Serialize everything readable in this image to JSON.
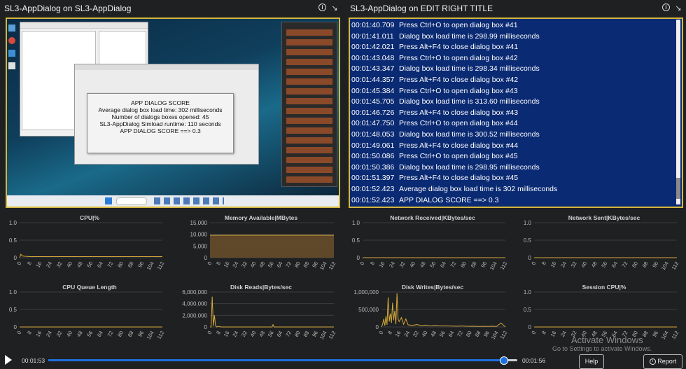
{
  "left_panel": {
    "title": "SL3-AppDialog on SL3-AppDialog"
  },
  "right_panel": {
    "title": "SL3-AppDialog on EDIT RIGHT TITLE"
  },
  "screenshot": {
    "dialog_title": "APP DIALOG SCORE",
    "dialog_lines": [
      "Average dialog box load time: 302 milliseconds",
      "Number of dialogs boxes opened: 45",
      "SL3-AppDialog Simload runtime: 110 seconds",
      "APP DIALOG SCORE ==> 0.3"
    ]
  },
  "log": [
    {
      "time": "00:01:40.709",
      "msg": "Press Ctrl+O to open dialog box #41"
    },
    {
      "time": "00:01:41.011",
      "msg": "Dialog box load time is 298.99 milliseconds"
    },
    {
      "time": "00:01:42.021",
      "msg": "Press Alt+F4 to close dialog box #41"
    },
    {
      "time": "00:01:43.048",
      "msg": "Press Ctrl+O to open dialog box #42"
    },
    {
      "time": "00:01:43.347",
      "msg": "Dialog box load time is 298.34 milliseconds"
    },
    {
      "time": "00:01:44.357",
      "msg": "Press Alt+F4 to close dialog box #42"
    },
    {
      "time": "00:01:45.384",
      "msg": "Press Ctrl+O to open dialog box #43"
    },
    {
      "time": "00:01:45.705",
      "msg": "Dialog box load time is 313.60 milliseconds"
    },
    {
      "time": "00:01:46.726",
      "msg": "Press Alt+F4 to close dialog box #43"
    },
    {
      "time": "00:01:47.750",
      "msg": "Press Ctrl+O to open dialog box #44"
    },
    {
      "time": "00:01:48.053",
      "msg": "Dialog box load time is 300.52 milliseconds"
    },
    {
      "time": "00:01:49.061",
      "msg": "Press Alt+F4 to close dialog box #44"
    },
    {
      "time": "00:01:50.086",
      "msg": "Press Ctrl+O to open dialog box #45"
    },
    {
      "time": "00:01:50.386",
      "msg": "Dialog box load time is 298.95 milliseconds"
    },
    {
      "time": "00:01:51.397",
      "msg": "Press Alt+F4 to close dialog box #45"
    },
    {
      "time": "00:01:52.423",
      "msg": "Average dialog box load time is 302 milliseconds"
    },
    {
      "time": "00:01:52.423",
      "msg": "APP DIALOG SCORE ==> 0.3"
    }
  ],
  "player": {
    "current": "00:01:53",
    "total": "00:01:56",
    "progress": 0.97,
    "help_label": "Help",
    "report_label": "Report"
  },
  "watermark": {
    "line1": "Activate Windows",
    "line2": "Go to Settings to activate Windows."
  },
  "colors": {
    "accent": "#d4b73c",
    "log_bg": "#0a2a73",
    "series": "#d4a93a",
    "slider": "#1e6fe0"
  },
  "chart_data": [
    {
      "type": "line",
      "title": "CPU|%",
      "yticks": [
        "1.0",
        "0.5",
        "0"
      ],
      "ylim": [
        0,
        1
      ],
      "xticks": [
        "0",
        "8",
        "16",
        "24",
        "32",
        "40",
        "48",
        "56",
        "64",
        "72",
        "80",
        "88",
        "96",
        "104",
        "112"
      ],
      "x": [
        0,
        1,
        2,
        4,
        8,
        16,
        24,
        32,
        40,
        48,
        56,
        64,
        72,
        80,
        88,
        96,
        104,
        112
      ],
      "y": [
        0,
        0.1,
        0.05,
        0.04,
        0.03,
        0.03,
        0.03,
        0.03,
        0.03,
        0.03,
        0.03,
        0.03,
        0.03,
        0.03,
        0.03,
        0.03,
        0.03,
        0.03
      ]
    },
    {
      "type": "area",
      "title": "Memory Available|MBytes",
      "yticks": [
        "15,000",
        "10,000",
        "5,000",
        "0"
      ],
      "ylim": [
        0,
        15000
      ],
      "xticks": [
        "0",
        "8",
        "16",
        "24",
        "32",
        "40",
        "48",
        "56",
        "64",
        "72",
        "80",
        "88",
        "96",
        "104",
        "112"
      ],
      "x": [
        0,
        112
      ],
      "y": [
        9600,
        9600
      ]
    },
    {
      "type": "line",
      "title": "Network Received|KBytes/sec",
      "yticks": [
        "1.0",
        "0.5",
        "0"
      ],
      "ylim": [
        0,
        1
      ],
      "xticks": [
        "0",
        "8",
        "16",
        "24",
        "32",
        "40",
        "48",
        "56",
        "64",
        "72",
        "80",
        "88",
        "96",
        "104",
        "112"
      ],
      "x": [
        0,
        112
      ],
      "y": [
        0,
        0
      ]
    },
    {
      "type": "line",
      "title": "Network Sent|KBytes/sec",
      "yticks": [
        "1.0",
        "0.5",
        "0"
      ],
      "ylim": [
        0,
        1
      ],
      "xticks": [
        "0",
        "8",
        "16",
        "24",
        "32",
        "40",
        "48",
        "56",
        "64",
        "72",
        "80",
        "88",
        "96",
        "104",
        "112"
      ],
      "x": [
        0,
        112
      ],
      "y": [
        0,
        0
      ]
    },
    {
      "type": "line",
      "title": "CPU Queue Length",
      "yticks": [
        "1.0",
        "0.5",
        "0"
      ],
      "ylim": [
        0,
        1
      ],
      "xticks": [
        "0",
        "8",
        "16",
        "24",
        "32",
        "40",
        "48",
        "56",
        "64",
        "72",
        "80",
        "88",
        "96",
        "104",
        "112"
      ],
      "x": [
        0,
        112
      ],
      "y": [
        0,
        0
      ]
    },
    {
      "type": "line",
      "title": "Disk Reads|Bytes/sec",
      "yticks": [
        "6,000,000",
        "4,000,000",
        "2,000,000",
        "0"
      ],
      "ylim": [
        0,
        6000000
      ],
      "xticks": [
        "0",
        "8",
        "16",
        "24",
        "32",
        "40",
        "48",
        "56",
        "64",
        "72",
        "80",
        "88",
        "96",
        "104",
        "112"
      ],
      "x": [
        0,
        1,
        2,
        3,
        4,
        5,
        6,
        8,
        10,
        20,
        40,
        48,
        56,
        57,
        58,
        64,
        80,
        112
      ],
      "y": [
        0,
        0,
        5200000,
        200000,
        2000000,
        300000,
        0,
        100000,
        0,
        0,
        0,
        0,
        0,
        400000,
        0,
        0,
        0,
        0
      ]
    },
    {
      "type": "line",
      "title": "Disk Writes|Bytes/sec",
      "yticks": [
        "1,000,000",
        "500,000",
        "0"
      ],
      "ylim": [
        0,
        1300000
      ],
      "xticks": [
        "0",
        "8",
        "16",
        "24",
        "32",
        "40",
        "48",
        "56",
        "64",
        "72",
        "80",
        "88",
        "96",
        "104",
        "112"
      ],
      "x": [
        0,
        1,
        2,
        3,
        4,
        5,
        6,
        7,
        8,
        9,
        10,
        11,
        12,
        13,
        14,
        15,
        16,
        18,
        20,
        22,
        24,
        28,
        32,
        36,
        40,
        44,
        48,
        52,
        56,
        60,
        64,
        68,
        72,
        76,
        80,
        84,
        88,
        92,
        96,
        100,
        104,
        108,
        112
      ],
      "y": [
        0,
        100000,
        300000,
        50000,
        400000,
        80000,
        1100000,
        200000,
        500000,
        150000,
        900000,
        250000,
        600000,
        100000,
        1250000,
        300000,
        200000,
        350000,
        100000,
        300000,
        80000,
        60000,
        90000,
        50000,
        70000,
        40000,
        60000,
        50000,
        45000,
        40000,
        35000,
        30000,
        40000,
        30000,
        25000,
        30000,
        20000,
        25000,
        20000,
        30000,
        20000,
        150000,
        0
      ]
    },
    {
      "type": "line",
      "title": "Session CPU|%",
      "yticks": [
        "1.0",
        "0.5",
        "0"
      ],
      "ylim": [
        0,
        1
      ],
      "xticks": [
        "0",
        "8",
        "16",
        "24",
        "32",
        "40",
        "48",
        "56",
        "64",
        "72",
        "80",
        "88",
        "96",
        "104",
        "112"
      ],
      "x": [
        0,
        112
      ],
      "y": [
        0,
        0
      ]
    }
  ]
}
